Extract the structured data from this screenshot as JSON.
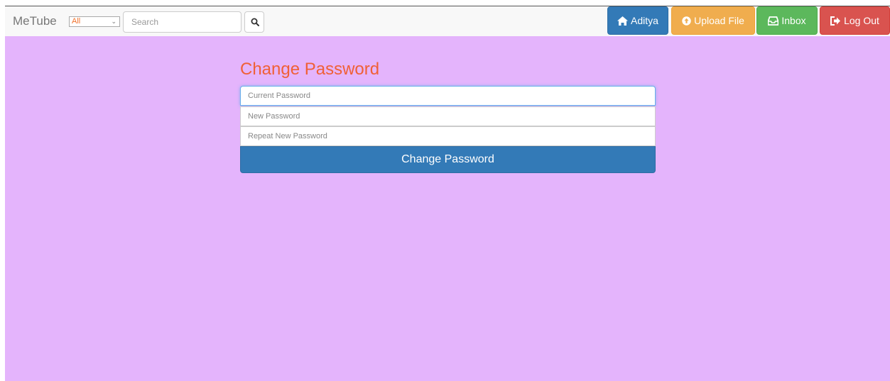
{
  "navbar": {
    "brand": "MeTube",
    "category": {
      "selected": "All"
    },
    "search": {
      "placeholder": "Search"
    },
    "buttons": {
      "user": "Aditya",
      "upload": "Upload File",
      "inbox": "Inbox",
      "logout": "Log Out"
    },
    "icons": {
      "search": "search-icon",
      "user": "home-icon",
      "upload": "upload-circle-icon",
      "inbox": "inbox-icon",
      "logout": "log-out-icon"
    }
  },
  "form": {
    "title": "Change Password",
    "fields": {
      "current": "Current Password",
      "new": "New Password",
      "repeat": "Repeat New Password"
    },
    "submit": "Change Password"
  },
  "colors": {
    "background": "#e4b4fc",
    "title": "#f06036",
    "primary": "#337ab7",
    "warning": "#f0ad4e",
    "success": "#5cb85c",
    "danger": "#d9534f"
  }
}
